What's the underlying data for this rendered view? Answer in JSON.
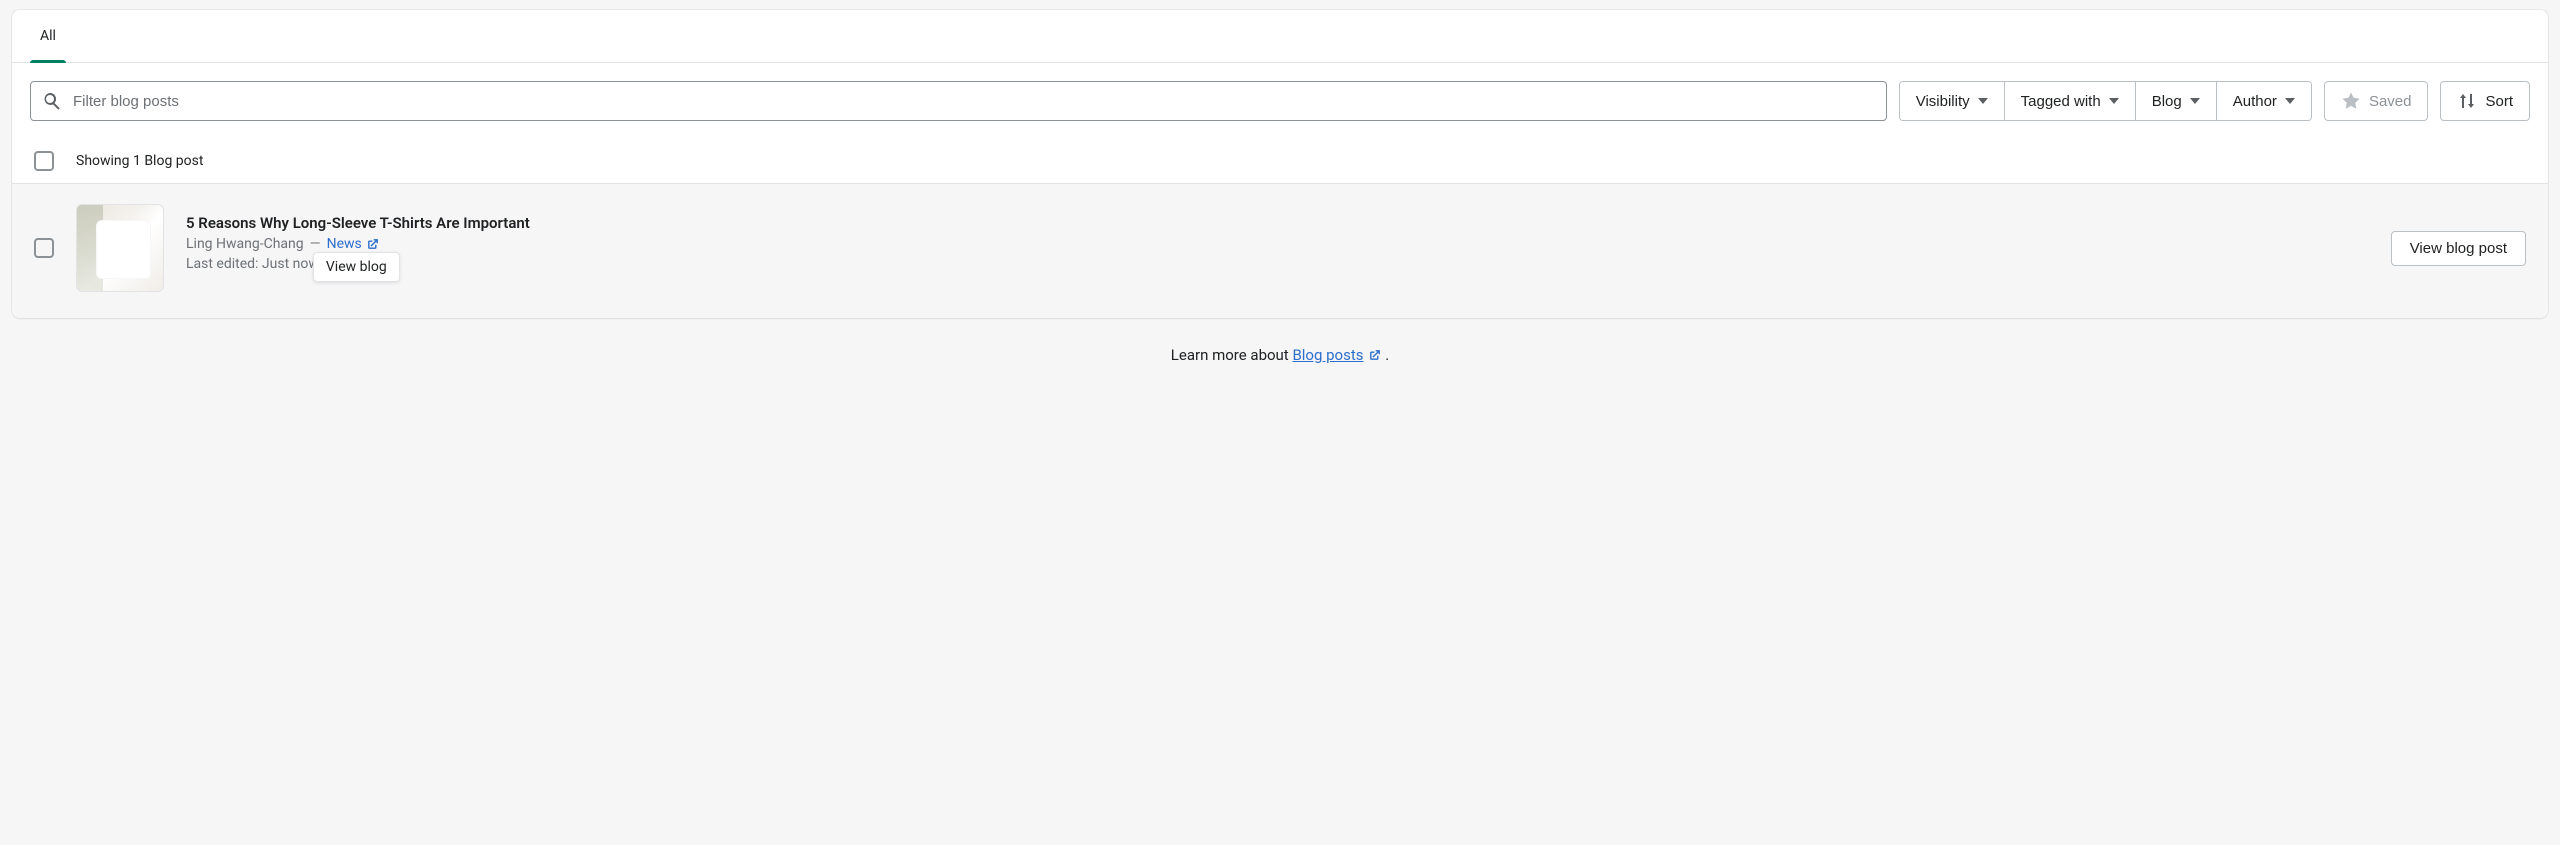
{
  "tabs": {
    "all": "All"
  },
  "search": {
    "placeholder": "Filter blog posts"
  },
  "filters": {
    "visibility": "Visibility",
    "tagged_with": "Tagged with",
    "blog": "Blog",
    "author": "Author"
  },
  "buttons": {
    "saved": "Saved",
    "sort": "Sort",
    "view_blog_post": "View blog post"
  },
  "list": {
    "showing": "Showing 1 Blog post"
  },
  "post": {
    "title": "5 Reasons Why Long-Sleeve T-Shirts Are Important",
    "author": "Ling Hwang-Chang",
    "separator": "—",
    "blog_name": "News",
    "last_edited_prefix": "Last edited: Just now",
    "tooltip": "View blog"
  },
  "footer": {
    "prefix": "Learn more about ",
    "link": "Blog posts",
    "suffix": " ."
  }
}
